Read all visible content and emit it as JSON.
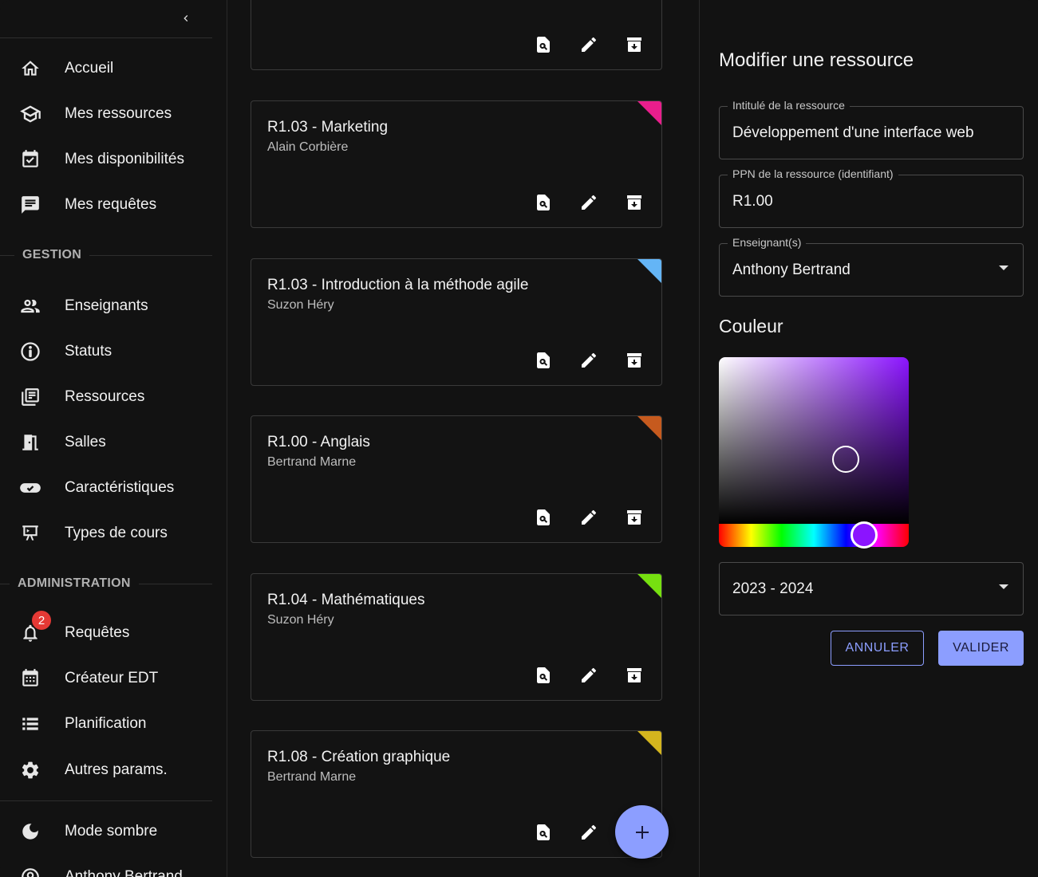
{
  "sidebar": {
    "items": [
      {
        "label": "Accueil",
        "icon": "home-icon"
      },
      {
        "label": "Mes ressources",
        "icon": "school-icon"
      },
      {
        "label": "Mes disponibilités",
        "icon": "calendar-check-icon"
      },
      {
        "label": "Mes requêtes",
        "icon": "message-text-icon"
      }
    ],
    "section_gestion": "GESTION",
    "gestion_items": [
      {
        "label": "Enseignants",
        "icon": "people-icon"
      },
      {
        "label": "Statuts",
        "icon": "person-circle-icon"
      },
      {
        "label": "Ressources",
        "icon": "library-books-icon"
      },
      {
        "label": "Salles",
        "icon": "door-icon"
      },
      {
        "label": "Caractéristiques",
        "icon": "toggle-icon"
      },
      {
        "label": "Types de cours",
        "icon": "presentation-icon"
      }
    ],
    "section_admin": "ADMINISTRATION",
    "admin_items": [
      {
        "label": "Requêtes",
        "icon": "bell-icon",
        "badge": "2"
      },
      {
        "label": "Créateur EDT",
        "icon": "calendar-grid-icon"
      },
      {
        "label": "Planification",
        "icon": "list-icon"
      },
      {
        "label": "Autres params.",
        "icon": "gear-icon"
      }
    ],
    "footer_items": [
      {
        "label": "Mode sombre",
        "icon": "moon-icon"
      },
      {
        "label": "Anthony Bertrand",
        "icon": "account-circle-icon"
      }
    ]
  },
  "cards": [
    {
      "title": "",
      "teacher": "",
      "color": ""
    },
    {
      "title": "R1.03 - Marketing",
      "teacher": "Alain Corbière",
      "color": "#e91e8c"
    },
    {
      "title": "R1.03 - Introduction à la méthode agile",
      "teacher": "Suzon Héry",
      "color": "#64b5f6"
    },
    {
      "title": "R1.00 - Anglais",
      "teacher": "Bertrand Marne",
      "color": "#c65a1e"
    },
    {
      "title": "R1.04 - Mathématiques",
      "teacher": "Suzon Héry",
      "color": "#76e010"
    },
    {
      "title": "R1.08 - Création graphique",
      "teacher": "Bertrand Marne",
      "color": "#d4b51e"
    }
  ],
  "form": {
    "title": "Modifier une ressource",
    "intitule_label": "Intitulé de la ressource",
    "intitule_value": "Développement d'une interface web",
    "ppn_label": "PPN de la ressource (identifiant)",
    "ppn_value": "R1.00",
    "enseignant_label": "Enseignant(s)",
    "enseignant_value": "Anthony Bertrand",
    "couleur_label": "Couleur",
    "selected_color": "#8b14ff",
    "annee_value": "2023 - 2024",
    "cancel_label": "ANNULER",
    "ok_label": "VALIDER"
  },
  "colors": {
    "background": "#121212",
    "accent": "#8c9eff",
    "badge": "#e53935"
  }
}
